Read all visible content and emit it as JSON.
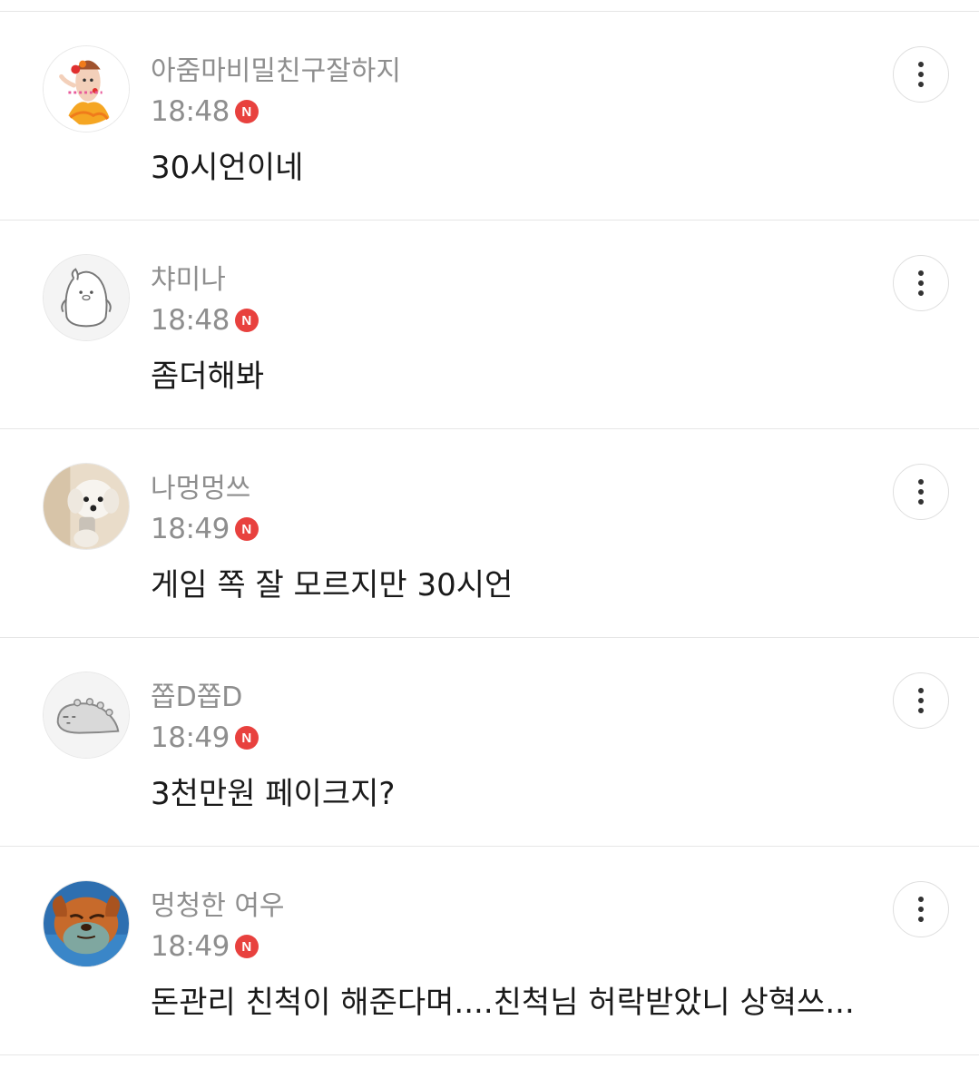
{
  "badge_label": "N",
  "colors": {
    "badge": "#e8413e",
    "meta_text": "#8e8e8e",
    "content_text": "#1a1a1a",
    "divider": "#e6e6e6"
  },
  "comments": [
    {
      "nickname": "아줌마비밀친구잘하지",
      "time": "18:48",
      "text": "30시언이네",
      "avatar": "dancing-character-avatar-icon",
      "more_icon": "more-vertical-icon"
    },
    {
      "nickname": "챠미나",
      "time": "18:48",
      "text": "좀더해봐",
      "avatar": "penguin-doodle-avatar-icon",
      "more_icon": "more-vertical-icon"
    },
    {
      "nickname": "나멍멍쓰",
      "time": "18:49",
      "text": "게임 쪽 잘 모르지만 30시언",
      "avatar": "white-dog-photo-avatar-icon",
      "more_icon": "more-vertical-icon"
    },
    {
      "nickname": "쫍D쫍D",
      "time": "18:49",
      "text": "3천만원 페이크지?",
      "avatar": "dino-doodle-avatar-icon",
      "more_icon": "more-vertical-icon"
    },
    {
      "nickname": "멍청한 여우",
      "time": "18:49",
      "text": "돈관리 친척이 해준다며....친척님 허락받았니 상혁쓰...",
      "avatar": "fox-character-avatar-icon",
      "more_icon": "more-vertical-icon"
    }
  ]
}
